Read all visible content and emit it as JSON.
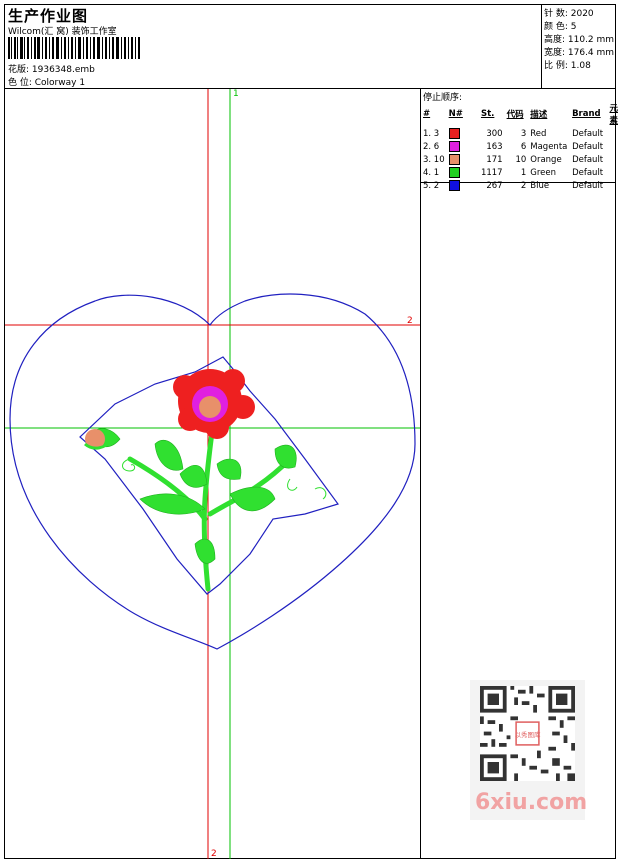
{
  "header": {
    "title": "生产作业图",
    "subtitle": "Wilcom(汇 窝) 装饰工作室",
    "file_line": "花版: 1936348.emb",
    "color_line": "色 位: Colorway 1"
  },
  "stats": {
    "stitches": "针 数: 2020",
    "colors": "颜 色: 5",
    "height": "高度: 110.2 mm",
    "width": "宽度: 176.4 mm",
    "scale": "比 例: 1.08"
  },
  "sequence": {
    "title": "停止顺序:",
    "headers": [
      "#",
      "N#",
      "St.",
      "代码",
      "描述",
      "Brand",
      "元素"
    ],
    "rows": [
      {
        "idx": "1. 3",
        "hex": "#e82020",
        "stitches": "300",
        "code": "3",
        "desc": "Red",
        "brand": "Default"
      },
      {
        "idx": "2. 6",
        "hex": "#e020e0",
        "stitches": "163",
        "code": "6",
        "desc": "Magenta",
        "brand": "Default"
      },
      {
        "idx": "3. 10",
        "hex": "#e8906a",
        "stitches": "171",
        "code": "10",
        "desc": "Orange",
        "brand": "Default"
      },
      {
        "idx": "4. 1",
        "hex": "#20d020",
        "stitches": "1117",
        "code": "1",
        "desc": "Green",
        "brand": "Default"
      },
      {
        "idx": "5. 2",
        "hex": "#1010e0",
        "stitches": "267",
        "code": "2",
        "desc": "Blue",
        "brand": "Default"
      }
    ]
  },
  "canvas": {
    "marker_1_top": "1",
    "marker_2_right": "2",
    "marker_2_bottom": "2",
    "colors": {
      "red_line": "#e00000",
      "green_line": "#00c000",
      "outline": "#2020c0",
      "petal_red": "#ee2020",
      "petal_magenta": "#e020e0",
      "center_orange": "#e8906a",
      "leaf_green": "#30e030"
    }
  },
  "watermark": {
    "text": "6xiu.com",
    "stamp": "以秀图库"
  }
}
